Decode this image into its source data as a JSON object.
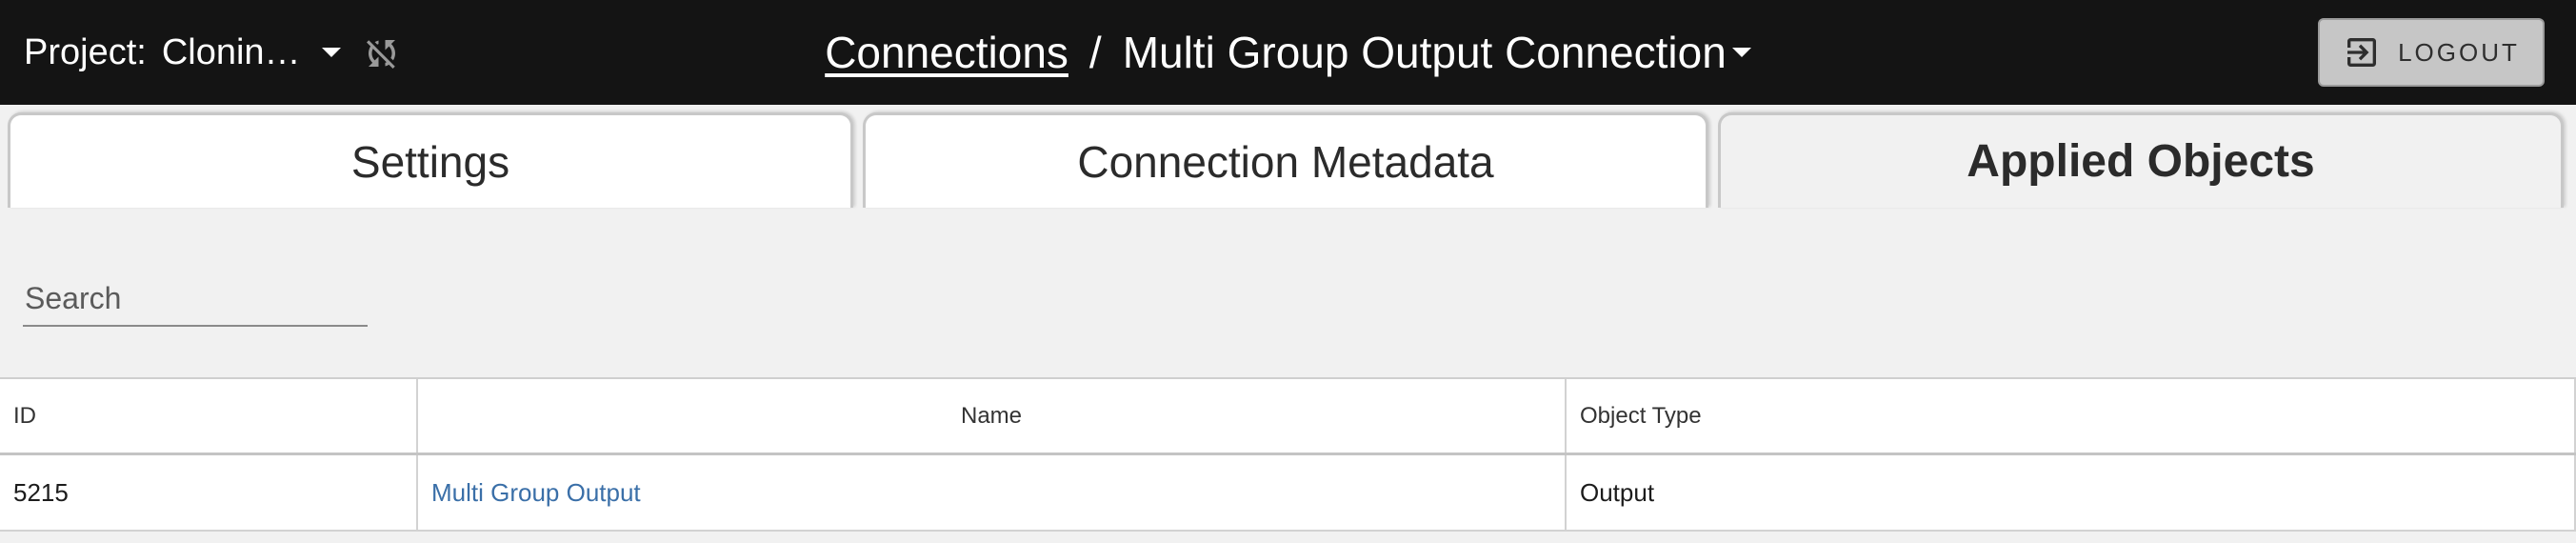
{
  "header": {
    "project_label": "Project:",
    "project_name": "Clonin…",
    "sync_icon": "sync-disabled-icon",
    "breadcrumb_root": "Connections",
    "breadcrumb_separator": "/",
    "breadcrumb_current": "Multi Group Output Connection",
    "logout_label": "LOGOUT",
    "logout_icon": "logout-icon"
  },
  "tabs": [
    {
      "label": "Settings",
      "active": false
    },
    {
      "label": "Connection Metadata",
      "active": false
    },
    {
      "label": "Applied Objects",
      "active": true
    }
  ],
  "search": {
    "placeholder": "Search",
    "value": ""
  },
  "table": {
    "columns": [
      "ID",
      "Name",
      "Object Type"
    ],
    "rows": [
      {
        "id": "5215",
        "name": "Multi Group Output",
        "object_type": "Output"
      }
    ]
  },
  "colors": {
    "topbar": "#141414",
    "background": "#f1f1f1",
    "link": "#3a6fa8",
    "logout_button": "#c6c6c6"
  }
}
